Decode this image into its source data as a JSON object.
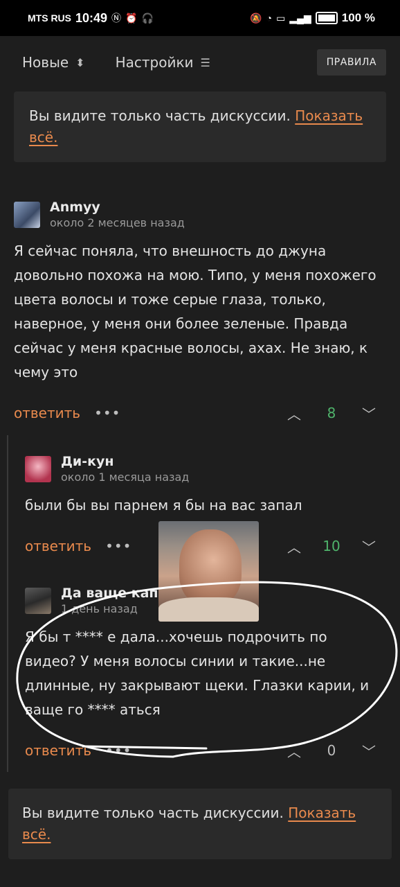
{
  "status_bar": {
    "carrier": "MTS RUS",
    "time": "10:49",
    "battery": "100 %"
  },
  "toolbar": {
    "sort_label": "Новые",
    "settings_label": "Настройки",
    "rules_label": "ПРАВИЛА"
  },
  "notice_top": {
    "text": "Вы видите только часть дискуссии. ",
    "link": "Показать всё."
  },
  "comments": [
    {
      "author": "Anmyy",
      "time": "около 2 месяцев назад",
      "text": "Я сейчас поняла, что внешность до джуна довольно похожа на мою. Типо, у меня похожего цвета волосы и тоже серые глаза, только, наверное, у меня они более зеленые. Правда сейчас у меня красные волосы, ахах. Не знаю, к чему это",
      "reply": "ответить",
      "score": "8"
    },
    {
      "author": "Ди-кун",
      "time": "около 1 месяца назад",
      "text": "были бы вы парнем я бы на вас запал",
      "reply": "ответить",
      "score": "10"
    },
    {
      "author": "Да ваще капе",
      "time": "1 день назад",
      "text": "Я бы т **** е дала...хочешь подрочить по видео? У меня волосы синии и такие...не длинные, ну закрывают щеки. Глазки карии, и ваще го **** аться",
      "reply": "ответить",
      "score": "0"
    }
  ],
  "notice_bottom": {
    "text": "Вы видите только часть дискуссии. ",
    "link": "Показать всё."
  }
}
